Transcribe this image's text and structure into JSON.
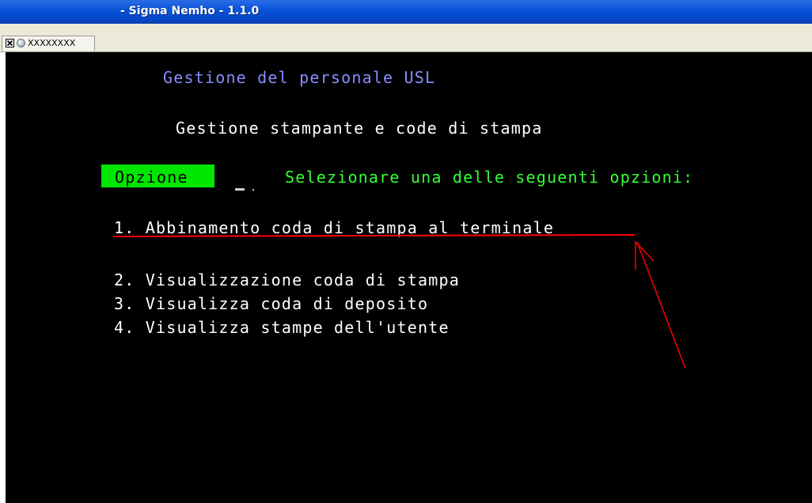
{
  "window": {
    "title": "- Sigma Nemho - 1.1.0"
  },
  "tabs": [
    {
      "label": "XXXXXXXX"
    }
  ],
  "terminal": {
    "header": "Gestione del personale USL",
    "subheader": "Gestione stampante e code di stampa",
    "option_label": "Opzione",
    "prompt": "Selezionare una delle seguenti opzioni:",
    "menu": [
      {
        "text": "1. Abbinamento coda di stampa al terminale"
      },
      {
        "text": "2. Visualizzazione coda di stampa"
      },
      {
        "text": "3. Visualizza coda di deposito"
      },
      {
        "text": "4. Visualizza stampe dell'utente"
      }
    ]
  },
  "colors": {
    "title_bar": "#0a54d8",
    "terminal_bg": "#000000",
    "header_text": "#8a8cff",
    "body_text": "#ffffff",
    "highlight_green": "#35ff35",
    "annotation_red": "#ff0000"
  },
  "icons": {
    "tab_close": "close-icon",
    "tab_status": "status-circle-icon"
  }
}
